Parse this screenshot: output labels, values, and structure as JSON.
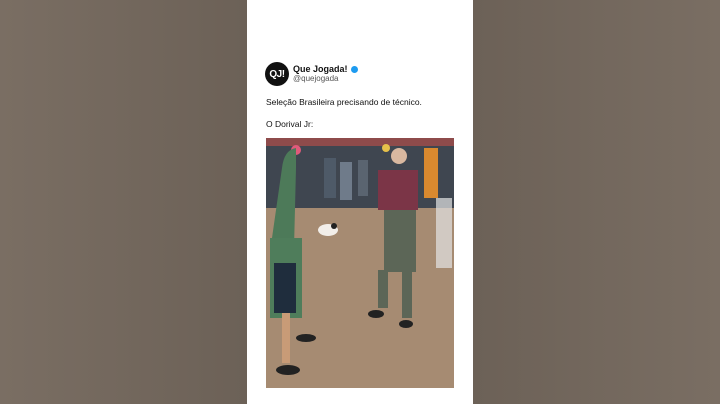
{
  "account": {
    "avatar_text": "QJ!",
    "display_name": "Que Jogada!",
    "handle": "@quejogada",
    "verified_color": "#1d9bf0"
  },
  "tweet": {
    "text": "Seleção Brasileira precisando de técnico.",
    "caption": "O Dorival Jr:"
  },
  "media": {
    "type": "video-frame",
    "description_icon": "video-still"
  }
}
